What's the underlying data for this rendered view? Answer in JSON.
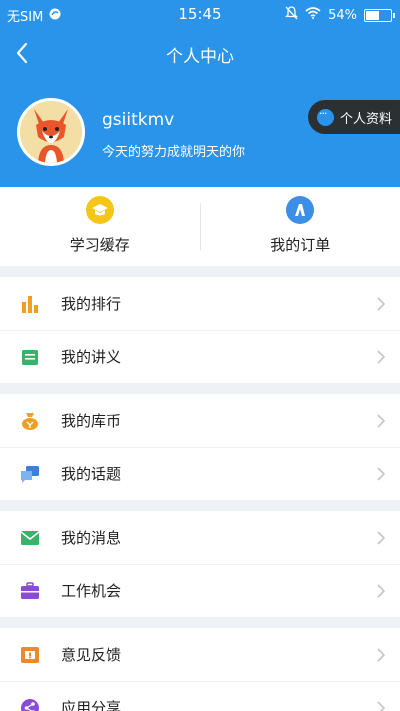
{
  "status_bar": {
    "carrier": "无SIM",
    "time": "15:45",
    "battery": "54%"
  },
  "nav": {
    "title": "个人中心"
  },
  "profile": {
    "username": "gsiitkmv",
    "motto": "今天的努力成就明天的你",
    "profile_button_label": "个人资料"
  },
  "quick_actions": [
    {
      "label": "学习缓存",
      "icon": "graduation-cap-icon",
      "color": "#f5c518"
    },
    {
      "label": "我的订单",
      "icon": "order-icon",
      "color": "#3b8fe6"
    }
  ],
  "menu_groups": [
    [
      {
        "label": "我的排行",
        "icon": "ranking-bars-icon"
      },
      {
        "label": "我的讲义",
        "icon": "handout-icon"
      }
    ],
    [
      {
        "label": "我的库币",
        "icon": "coin-bag-icon"
      },
      {
        "label": "我的话题",
        "icon": "topic-chat-icon"
      }
    ],
    [
      {
        "label": "我的消息",
        "icon": "message-envelope-icon"
      },
      {
        "label": "工作机会",
        "icon": "briefcase-icon"
      }
    ],
    [
      {
        "label": "意见反馈",
        "icon": "feedback-icon"
      },
      {
        "label": "应用分享",
        "icon": "share-icon"
      }
    ]
  ],
  "colors": {
    "header_bg": "#2a94ea",
    "page_bg": "#eef1f5",
    "profile_button_bg": "#2b3033",
    "ranking": "#f0a020",
    "handout": "#39b36a",
    "coin": "#f0a020",
    "topic": "#3b7fe0",
    "message": "#39b36a",
    "briefcase": "#8a4bd6",
    "feedback": "#e88a2e",
    "share": "#8a4bd6"
  }
}
